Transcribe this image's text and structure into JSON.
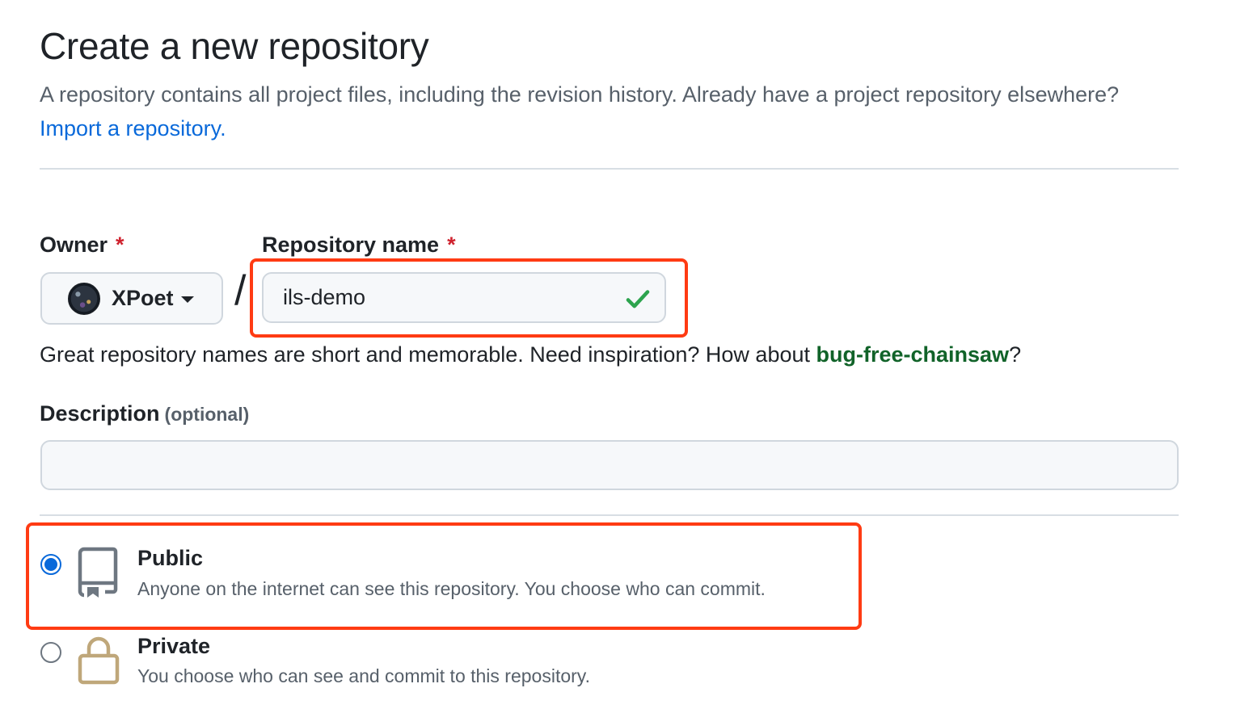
{
  "header": {
    "title": "Create a new repository",
    "subtitle": "A repository contains all project files, including the revision history. Already have a project repository elsewhere?",
    "import_link": "Import a repository."
  },
  "owner": {
    "label": "Owner",
    "required_mark": "*",
    "selected": "XPoet"
  },
  "separator": "/",
  "repo_name": {
    "label": "Repository name",
    "required_mark": "*",
    "value": "ils-demo",
    "valid": true
  },
  "hint": {
    "text": "Great repository names are short and memorable. Need inspiration? How about",
    "suggestion": "bug-free-chainsaw",
    "suffix": "?"
  },
  "description": {
    "label": "Description",
    "optional": "(optional)",
    "value": ""
  },
  "visibility": {
    "options": [
      {
        "title": "Public",
        "description": "Anyone on the internet can see this repository. You choose who can commit.",
        "selected": true,
        "icon": "repo-icon"
      },
      {
        "title": "Private",
        "description": "You choose who can see and commit to this repository.",
        "selected": false,
        "icon": "lock-icon"
      }
    ]
  },
  "colors": {
    "link": "#0969da",
    "success": "#1a7f37",
    "required": "#cf222e",
    "highlight": "#ff3b13"
  }
}
